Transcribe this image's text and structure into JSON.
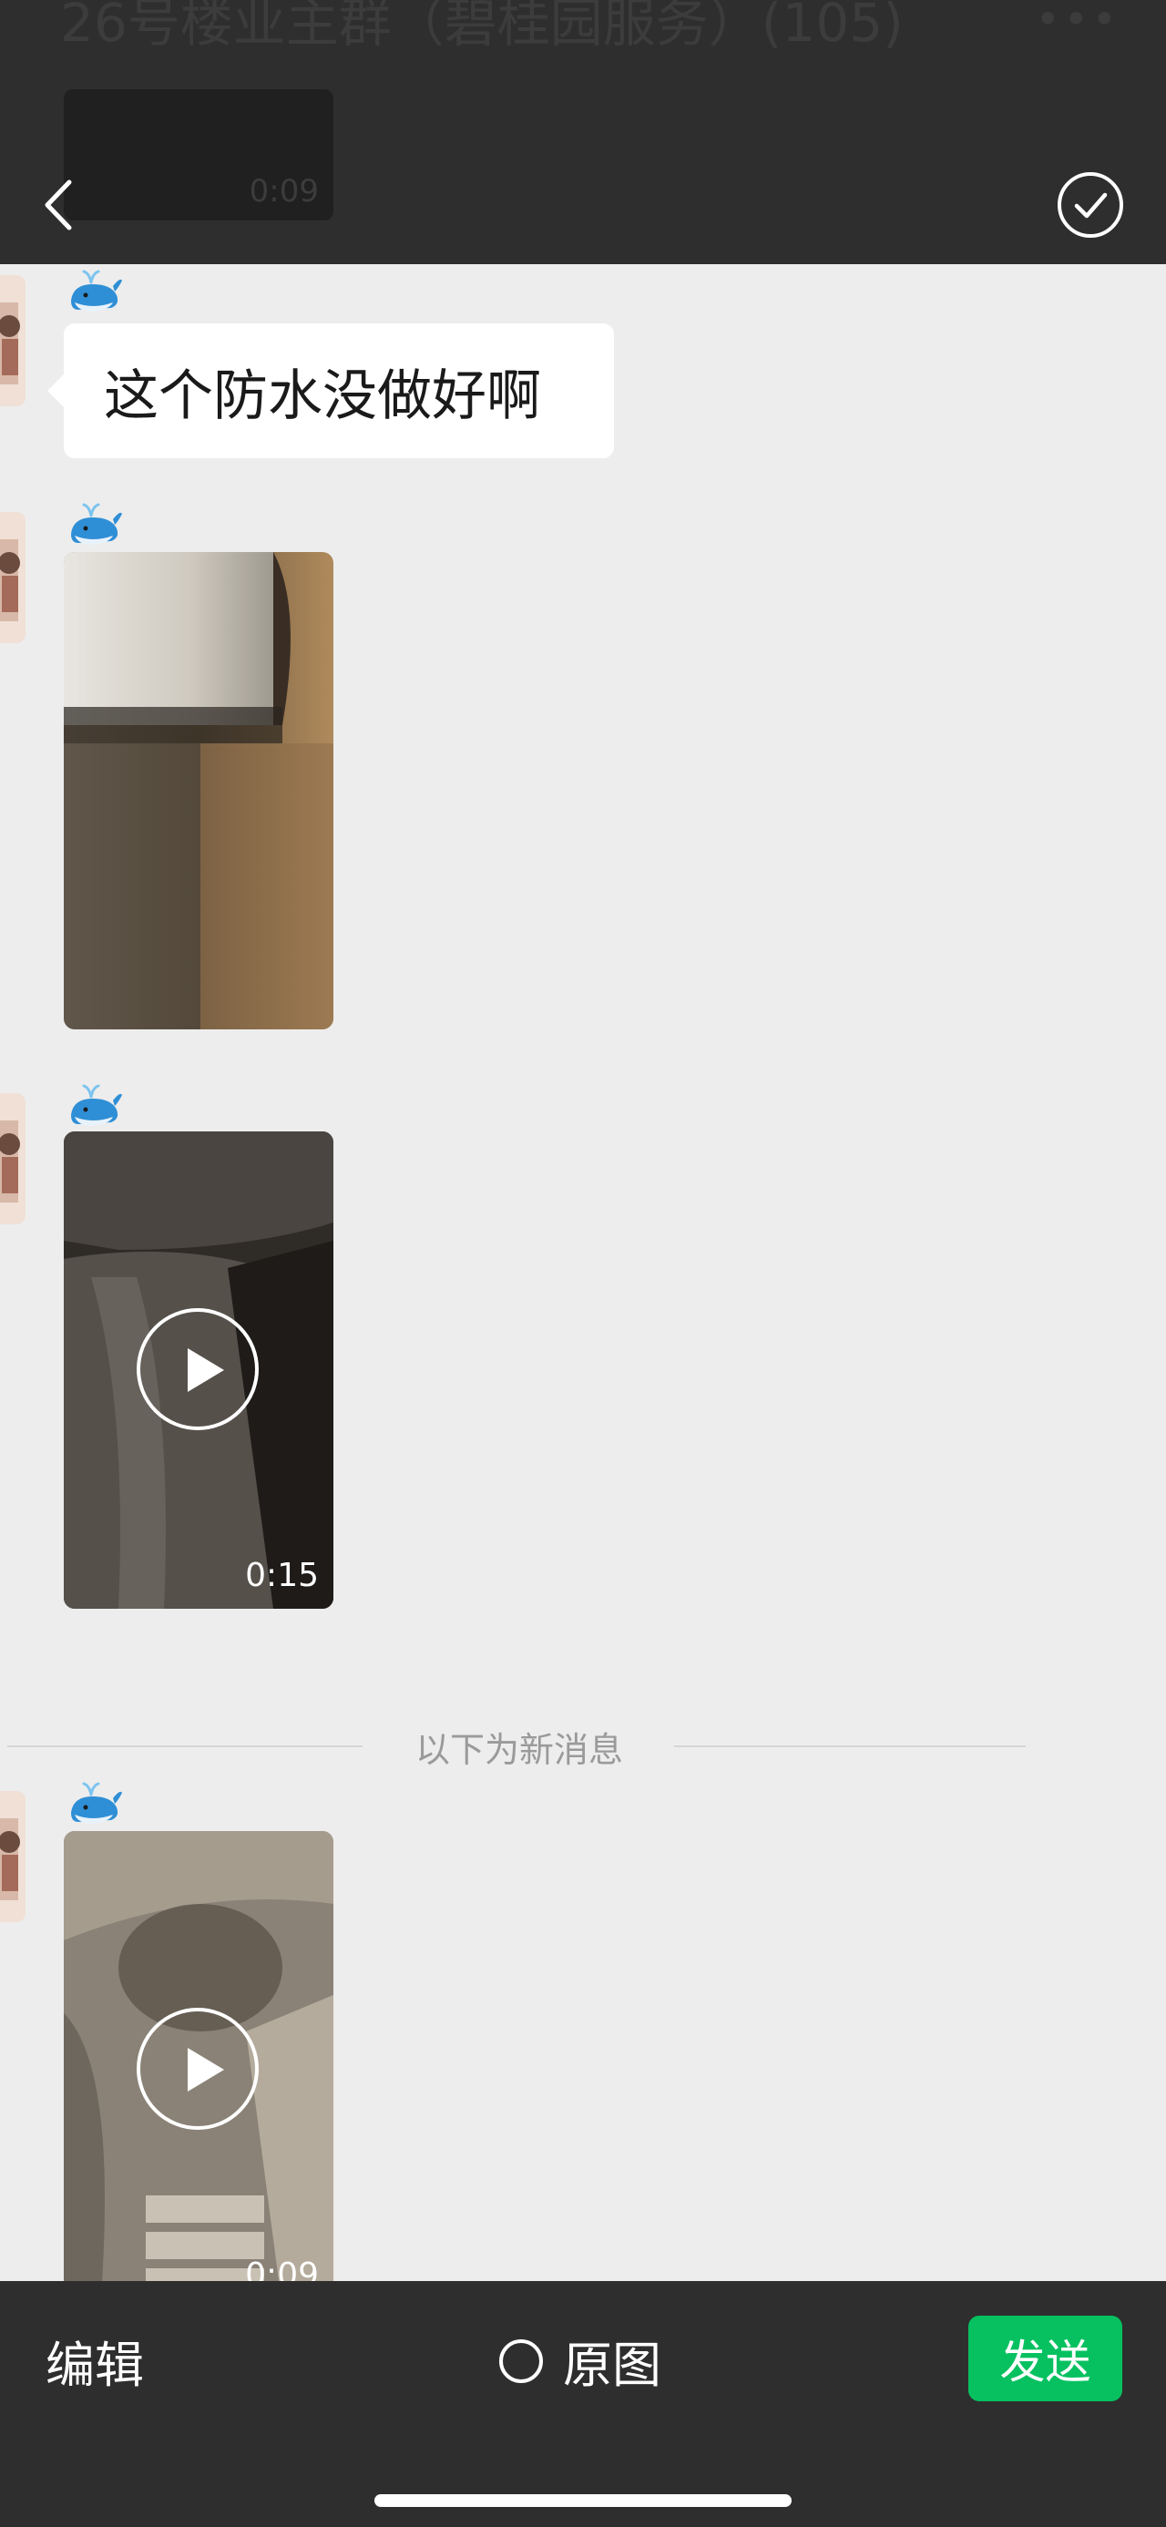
{
  "header": {
    "chat_title": "26号楼业主群（碧桂园服务）(105)",
    "more_label": "•••",
    "ghost_video_duration": "0:09",
    "back_icon": "chevron-left-icon",
    "confirm_icon": "check-circle-icon"
  },
  "messages": [
    {
      "type": "text",
      "sender_icon": "whale-emoji-icon",
      "text": "这个防水没做好啊"
    },
    {
      "type": "image",
      "sender_icon": "whale-emoji-icon"
    },
    {
      "type": "video",
      "sender_icon": "whale-emoji-icon",
      "duration": "0:15"
    },
    {
      "type": "video",
      "sender_icon": "whale-emoji-icon",
      "duration": "0:09"
    }
  ],
  "divider": {
    "label": "以下为新消息"
  },
  "footer": {
    "edit_label": "编辑",
    "original_label": "原图",
    "send_label": "发送"
  },
  "colors": {
    "bar_bg": "#2e2e2e",
    "chat_bg": "#ededed",
    "send_green": "#07c160",
    "bubble_bg": "#ffffff"
  }
}
